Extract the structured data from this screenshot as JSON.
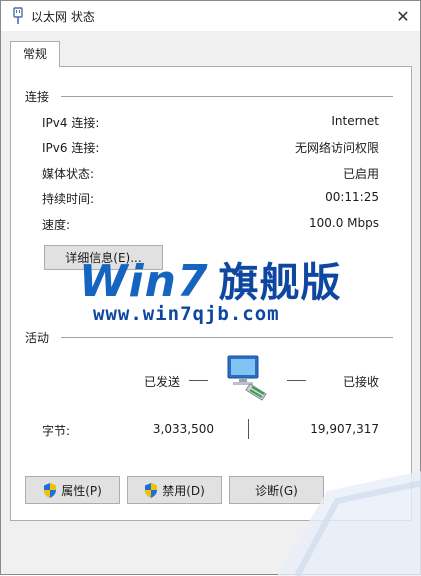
{
  "window": {
    "title": "以太网 状态",
    "close_glyph": "✕"
  },
  "tabs": [
    {
      "label": "常规"
    }
  ],
  "connection": {
    "heading": "连接",
    "rows": [
      {
        "label": "IPv4 连接:",
        "value": "Internet"
      },
      {
        "label": "IPv6 连接:",
        "value": "无网络访问权限"
      },
      {
        "label": "媒体状态:",
        "value": "已启用"
      },
      {
        "label": "持续时间:",
        "value": "00:11:25"
      },
      {
        "label": "速度:",
        "value": "100.0 Mbps"
      }
    ],
    "details_button": "详细信息(E)..."
  },
  "activity": {
    "heading": "活动",
    "sent_label": "已发送",
    "received_label": "已接收",
    "bytes_label": "字节:",
    "bytes_sent": "3,033,500",
    "bytes_received": "19,907,317"
  },
  "buttons": {
    "properties": "属性(P)",
    "disable": "禁用(D)",
    "diagnose": "诊断(G)"
  },
  "watermark": {
    "logo_text": "Win7",
    "logo_cn": "旗舰版",
    "url": "www.win7qjb.com"
  },
  "colors": {
    "accent": "#0d47a1",
    "shield_blue": "#1e6fd9",
    "shield_yellow": "#f2c200"
  },
  "icons": {
    "title": "ethernet-plug-icon",
    "network": "network-computer-icon",
    "shield": "uac-shield-icon"
  }
}
